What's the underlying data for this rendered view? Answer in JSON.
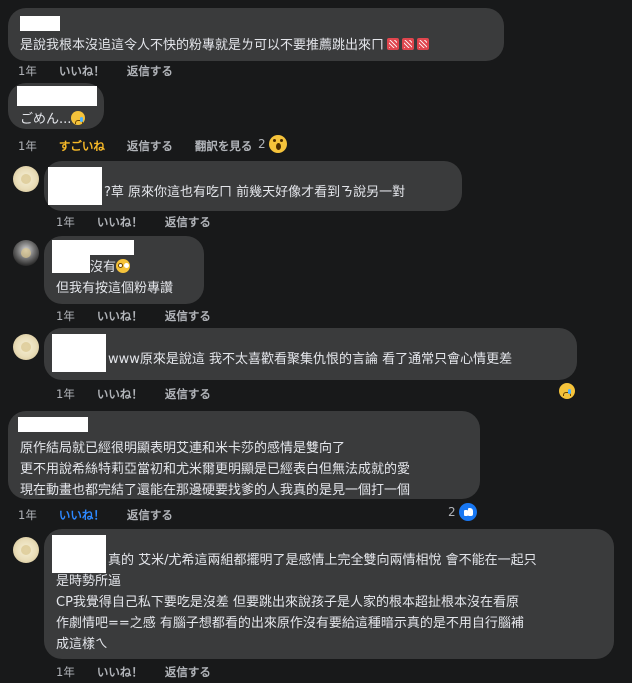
{
  "labels": {
    "time": "1年",
    "like": "いいね！",
    "reply": "返信する",
    "translate": "翻訳を見る",
    "wow_like": "すごいね"
  },
  "comments": [
    {
      "text": "是說我根本沒追這令人不快的粉專就是ㄌ可以不要推薦跳出來ㄇ",
      "reaction_icon": "anger-symbol-icon"
    },
    {
      "text": "ごめん..."
    },
    {
      "text": "?草 原來你這也有吃ㄇ 前幾天好像才看到ㄋ說另一對"
    },
    {
      "line1": "沒有",
      "line2": "但我有按這個粉專讚"
    },
    {
      "text": "www原來是說這 我不太喜歡看聚集仇恨的言論 看了通常只會心情更差"
    },
    {
      "lines": [
        "原作結局就已經很明顯表明艾連和米卡莎的感情是雙向了",
        "更不用說希絲特莉亞當初和尤米爾更明顯是已經表白但無法成就的愛",
        "現在動畫也都完結了還能在那邊硬要找爹的人我真的是見一個打一個"
      ]
    },
    {
      "lines": [
        "真的 艾米/尤希這兩組都擺明了是感情上完全雙向兩情相悅 會不能在一起只",
        "是時勢所逼",
        "CP我覺得自己私下要吃是沒差 但要跳出來說孩子是人家的根本超扯根本沒在看原",
        "作劇情吧==之感 有腦子想都看的出來原作沒有要給這種暗示真的是不用自行腦補",
        "成這樣ㄟ"
      ]
    }
  ],
  "reaction_counts": {
    "c2": "2",
    "c6": "2"
  }
}
